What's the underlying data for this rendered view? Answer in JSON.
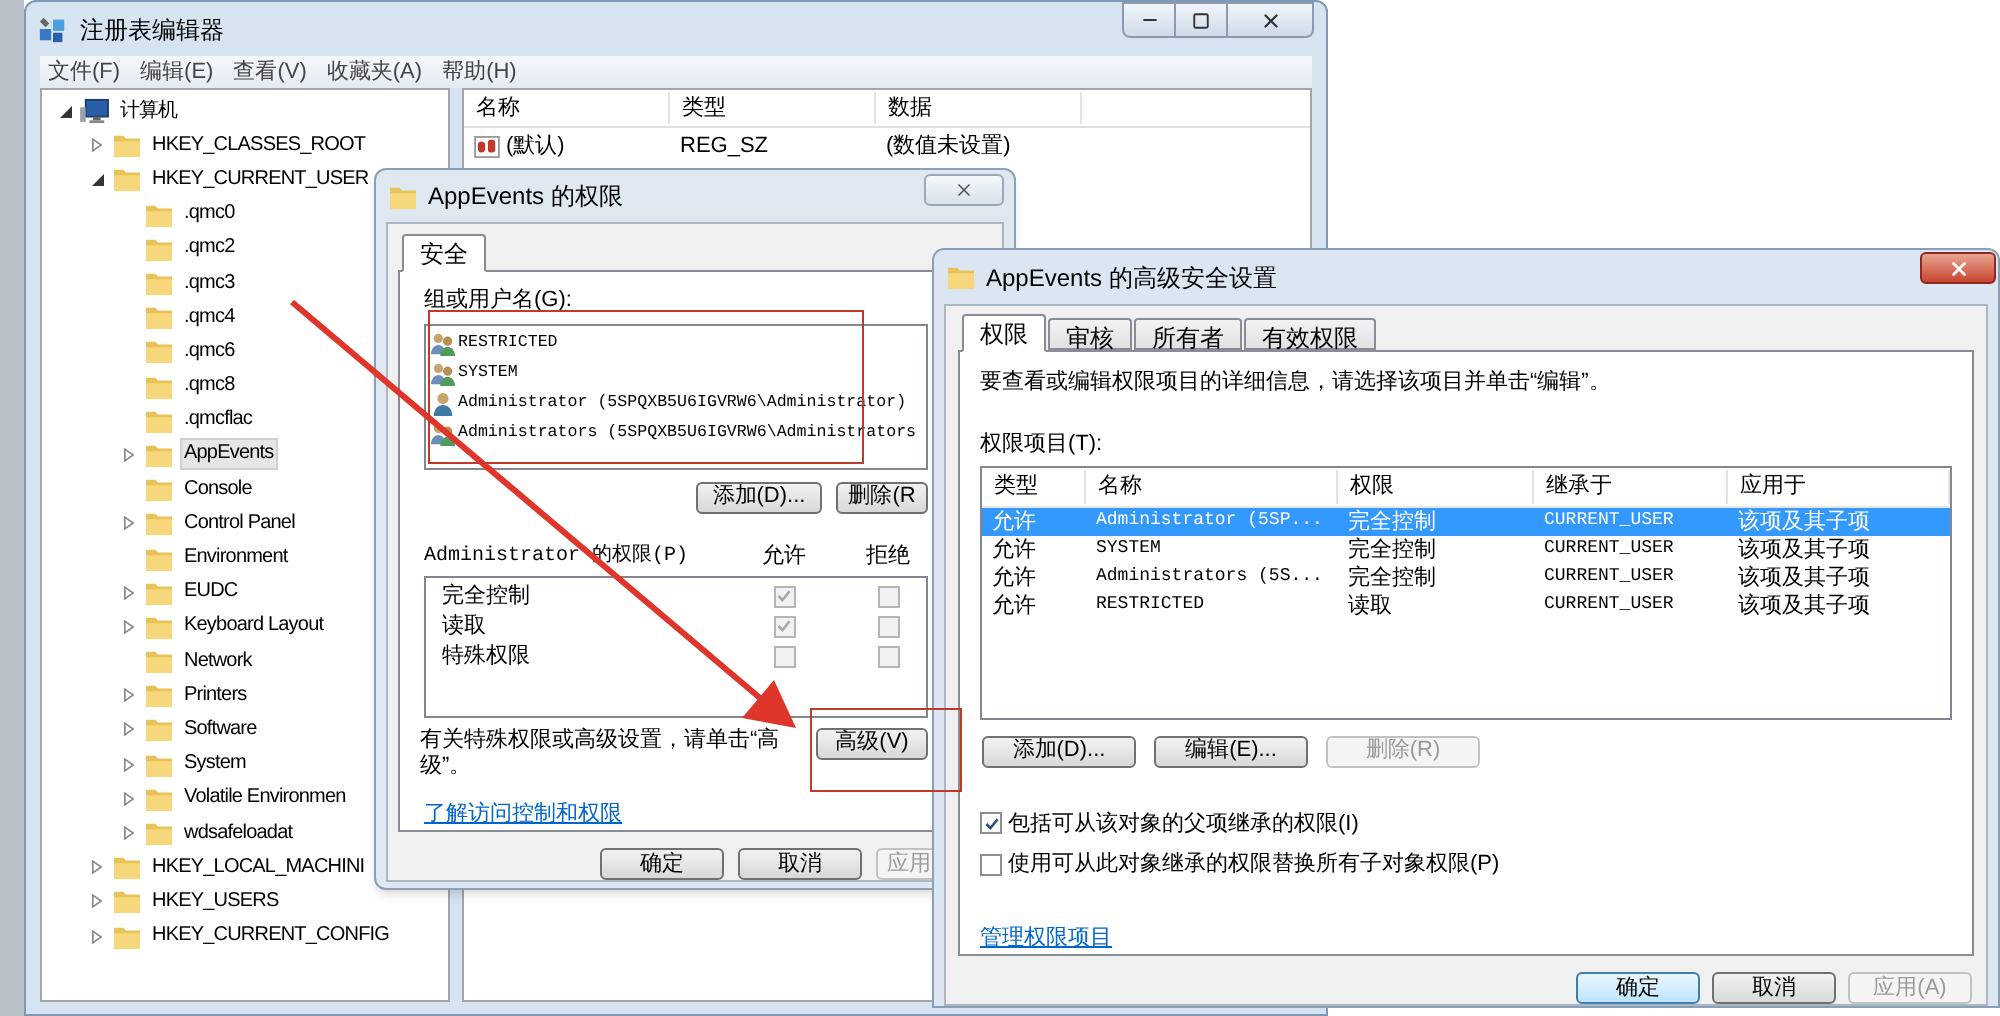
{
  "registry_editor": {
    "title": "注册表编辑器",
    "menu": [
      "文件(F)",
      "编辑(E)",
      "查看(V)",
      "收藏夹(A)",
      "帮助(H)"
    ],
    "tree": [
      {
        "label": "计算机",
        "kind": "computer",
        "expanded": true,
        "selected": false,
        "children": [
          {
            "label": "HKEY_CLASSES_ROOT",
            "kind": "folder",
            "expanded": false,
            "selected": false
          },
          {
            "label": "HKEY_CURRENT_USER",
            "kind": "folder",
            "expanded": true,
            "selected": false,
            "children": [
              {
                "label": ".qmc0",
                "kind": "folder",
                "selected": false
              },
              {
                "label": ".qmc2",
                "kind": "folder",
                "selected": false
              },
              {
                "label": ".qmc3",
                "kind": "folder",
                "selected": false
              },
              {
                "label": ".qmc4",
                "kind": "folder",
                "selected": false
              },
              {
                "label": ".qmc6",
                "kind": "folder",
                "selected": false
              },
              {
                "label": ".qmc8",
                "kind": "folder",
                "selected": false
              },
              {
                "label": ".qmcflac",
                "kind": "folder",
                "selected": false
              },
              {
                "label": "AppEvents",
                "kind": "folder",
                "expanded": false,
                "selected": true
              },
              {
                "label": "Console",
                "kind": "folder",
                "selected": false
              },
              {
                "label": "Control Panel",
                "kind": "folder",
                "expanded": false,
                "selected": false
              },
              {
                "label": "Environment",
                "kind": "folder",
                "selected": false
              },
              {
                "label": "EUDC",
                "kind": "folder",
                "expanded": false,
                "selected": false
              },
              {
                "label": "Keyboard Layout",
                "kind": "folder",
                "expanded": false,
                "selected": false
              },
              {
                "label": "Network",
                "kind": "folder",
                "selected": false
              },
              {
                "label": "Printers",
                "kind": "folder",
                "expanded": false,
                "selected": false
              },
              {
                "label": "Software",
                "kind": "folder",
                "expanded": false,
                "selected": false
              },
              {
                "label": "System",
                "kind": "folder",
                "expanded": false,
                "selected": false
              },
              {
                "label": "Volatile Environmen",
                "kind": "folder",
                "expanded": false,
                "selected": false
              },
              {
                "label": "wdsafeloadat",
                "kind": "folder",
                "expanded": false,
                "selected": false
              }
            ]
          },
          {
            "label": "HKEY_LOCAL_MACHINI",
            "kind": "folder",
            "expanded": false,
            "selected": false
          },
          {
            "label": "HKEY_USERS",
            "kind": "folder",
            "expanded": false,
            "selected": false
          },
          {
            "label": "HKEY_CURRENT_CONFIG",
            "kind": "folder",
            "expanded": false,
            "selected": false
          }
        ]
      }
    ],
    "values": {
      "columns": [
        "名称",
        "类型",
        "数据"
      ],
      "rows": [
        {
          "cells": [
            "(默认)",
            "REG_SZ",
            "(数值未设置)"
          ]
        }
      ]
    }
  },
  "permissions_dialog": {
    "title": "AppEvents 的权限",
    "tabs": [
      {
        "label": "安全",
        "selected": true
      }
    ],
    "users_label": "组或用户名(G):",
    "users": [
      {
        "name": "RESTRICTED",
        "kind": "group"
      },
      {
        "name": "SYSTEM",
        "kind": "group"
      },
      {
        "name": "Administrator (5SPQXB5U6IGVRW6\\Administrator)",
        "kind": "user"
      },
      {
        "name": "Administrators (5SPQXB5U6IGVRW6\\Administrators",
        "kind": "group"
      }
    ],
    "buttons": [
      {
        "label": "添加(D)...",
        "disabled": false
      },
      {
        "label": "删除(R",
        "disabled": false
      }
    ],
    "permissions_label": "Administrator 的权限(P)",
    "allow_header": "允许",
    "deny_header": "拒绝",
    "permissions": [
      {
        "name": "完全控制",
        "allow": true,
        "deny": false
      },
      {
        "name": "读取",
        "allow": true,
        "deny": false
      },
      {
        "name": "特殊权限",
        "allow": false,
        "deny": false
      }
    ],
    "advanced_note": "有关特殊权限或高级设置，请单击“高级”。",
    "advanced_button": "高级(V)",
    "link": "了解访问控制和权限",
    "footer_buttons": [
      {
        "label": "确定",
        "disabled": false
      },
      {
        "label": "取消",
        "disabled": false
      },
      {
        "label": "应用",
        "disabled": true
      }
    ]
  },
  "advanced_dialog": {
    "title": "AppEvents 的高级安全设置",
    "tabs": [
      {
        "label": "权限",
        "selected": true
      },
      {
        "label": "审核",
        "selected": false
      },
      {
        "label": "所有者",
        "selected": false
      },
      {
        "label": "有效权限",
        "selected": false
      }
    ],
    "intro": "要查看或编辑权限项目的详细信息，请选择该项目并单击“编辑”。",
    "entries_label": "权限项目(T):",
    "columns": [
      "类型",
      "名称",
      "权限",
      "继承于",
      "应用于"
    ],
    "rows": [
      {
        "selected": true,
        "cells": [
          "允许",
          "Administrator (5SP...",
          "完全控制",
          "CURRENT_USER",
          "该项及其子项"
        ]
      },
      {
        "selected": false,
        "cells": [
          "允许",
          "SYSTEM",
          "完全控制",
          "CURRENT_USER",
          "该项及其子项"
        ]
      },
      {
        "selected": false,
        "cells": [
          "允许",
          "Administrators (5S...",
          "完全控制",
          "CURRENT_USER",
          "该项及其子项"
        ]
      },
      {
        "selected": false,
        "cells": [
          "允许",
          "RESTRICTED",
          "读取",
          "CURRENT_USER",
          "该项及其子项"
        ]
      }
    ],
    "buttons": [
      {
        "label": "添加(D)...",
        "disabled": false
      },
      {
        "label": "编辑(E)...",
        "disabled": false
      },
      {
        "label": "删除(R)",
        "disabled": true
      }
    ],
    "checkboxes": [
      {
        "label": "包括可从该对象的父项继承的权限(I)",
        "checked": true
      },
      {
        "label": "使用可从此对象继承的权限替换所有子对象权限(P)",
        "checked": false
      }
    ],
    "link": "管理权限项目",
    "footer_buttons": [
      {
        "label": "确定",
        "disabled": false,
        "default": true
      },
      {
        "label": "取消",
        "disabled": false,
        "default": false
      },
      {
        "label": "应用(A)",
        "disabled": true,
        "default": false
      }
    ]
  }
}
